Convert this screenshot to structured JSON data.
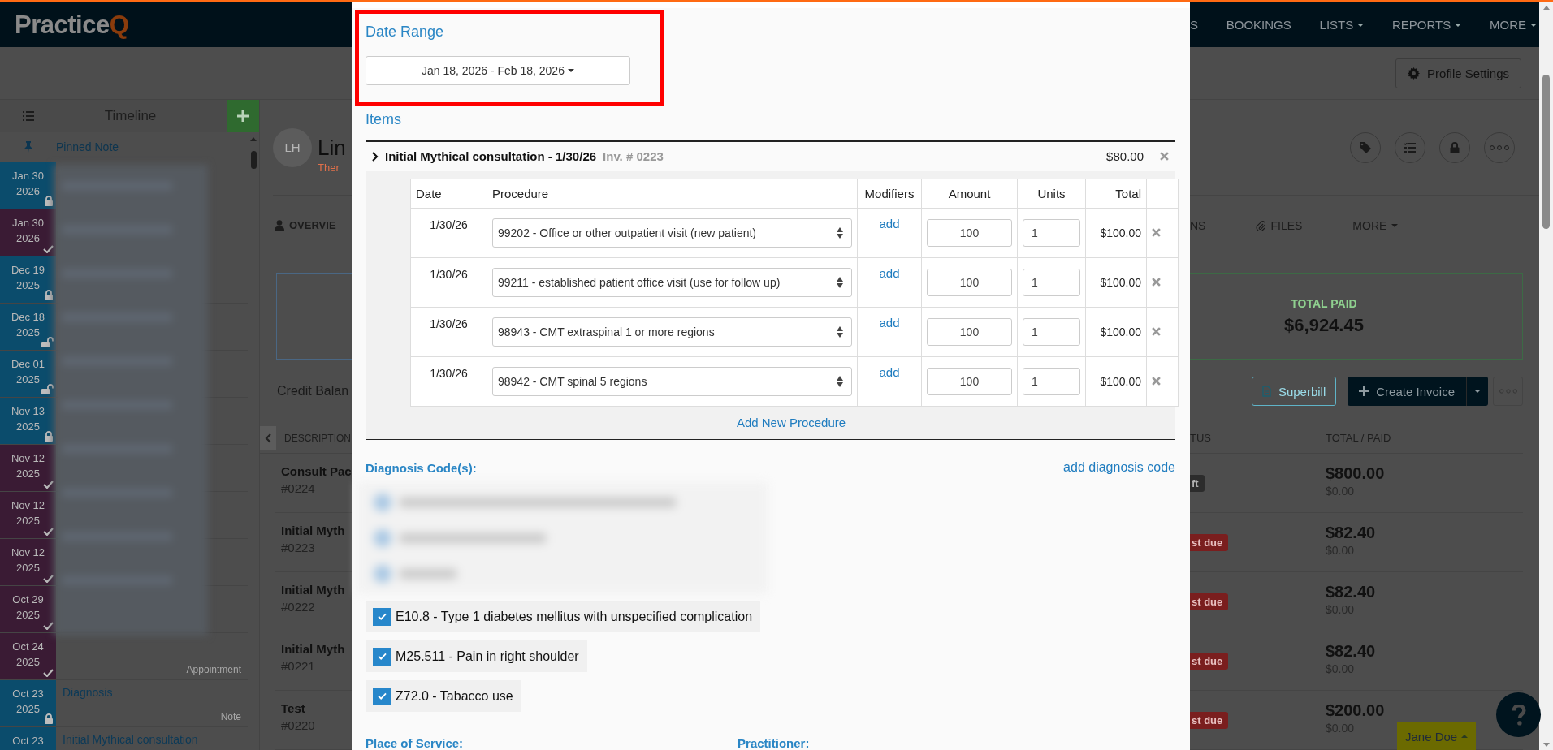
{
  "nav": {
    "logo": {
      "text": "Practice",
      "accent": "Q"
    },
    "items": [
      {
        "label": "S",
        "dropdown": false
      },
      {
        "label": "BOOKINGS",
        "dropdown": false
      },
      {
        "label": "LISTS",
        "dropdown": true
      },
      {
        "label": "REPORTS",
        "dropdown": true
      },
      {
        "label": "MORE",
        "dropdown": true
      }
    ]
  },
  "toolbar": {
    "button": "Profile Settings"
  },
  "timeline": {
    "title": "Timeline",
    "pinned": "Pinned Note",
    "entries": [
      {
        "date": "Jan 30",
        "year": "2026",
        "kind": "note",
        "locked": true
      },
      {
        "date": "Jan 30",
        "year": "2026",
        "kind": "appointment",
        "checked": true
      },
      {
        "date": "Dec 19",
        "year": "2025",
        "kind": "note",
        "locked": true
      },
      {
        "date": "Dec 18",
        "year": "2025",
        "kind": "note",
        "locked": false
      },
      {
        "date": "Dec 01",
        "year": "2025",
        "kind": "note",
        "locked": false
      },
      {
        "date": "Nov 13",
        "year": "2025",
        "kind": "note",
        "locked": true
      },
      {
        "date": "Nov 12",
        "year": "2025",
        "kind": "appointment",
        "checked": true
      },
      {
        "date": "Nov 12",
        "year": "2025",
        "kind": "appointment",
        "checked": true
      },
      {
        "date": "Nov 12",
        "year": "2025",
        "kind": "appointment",
        "checked": true
      },
      {
        "date": "Oct 29",
        "year": "2025",
        "kind": "appointment",
        "checked": true
      },
      {
        "date": "Oct 24",
        "year": "2025",
        "kind": "appointment",
        "checked": true,
        "type": "Appointment"
      },
      {
        "date": "Oct 23",
        "year": "2025",
        "kind": "note",
        "locked": true,
        "title": "Diagnosis",
        "type": "Note"
      },
      {
        "date": "Oct 23",
        "kind": "note",
        "title": "Initial Mythical consultation"
      }
    ]
  },
  "profile": {
    "initials": "LH",
    "name": "Lin",
    "subtitle": "Ther"
  },
  "profile_tabs_left": [
    {
      "label": "OVERVIE"
    }
  ],
  "profile_tabs_right": [
    {
      "label": "NS",
      "dropdown": false
    },
    {
      "label": "FILES",
      "dropdown": false
    },
    {
      "label": "MORE",
      "dropdown": true
    }
  ],
  "summary": {
    "label": "TOTAL PAID",
    "value": "$6,924.45"
  },
  "credit_balance": "Credit Balan",
  "invoice_actions": {
    "superbill": "Superbill",
    "create": "Create Invoice"
  },
  "invoices": {
    "columns_left": [
      "DESCRIPTION"
    ],
    "columns_right": [
      "TUS",
      "TOTAL / PAID"
    ],
    "rows": [
      {
        "description": "Consult Pac",
        "number": "#0224",
        "status": "ft",
        "kind": "draft",
        "total": "$800.00",
        "paid": "$0.00"
      },
      {
        "description": "Initial Myth",
        "number": "#0223",
        "status": "st due",
        "kind": "overdue",
        "total": "$82.40",
        "paid": "$0.00"
      },
      {
        "description": "Initial Myth",
        "number": "#0222",
        "status": "st due",
        "kind": "overdue",
        "total": "$82.40",
        "paid": "$0.00"
      },
      {
        "description": "Initial Myth",
        "number": "#0221",
        "status": "st due",
        "kind": "overdue",
        "total": "$82.40",
        "paid": "$0.00"
      },
      {
        "description": "Test",
        "number": "#0220",
        "status": "st due",
        "kind": "overdue",
        "total": "$200.00",
        "paid": "$0.00"
      }
    ]
  },
  "user_menu": "Jane Doe",
  "modal": {
    "date_range": {
      "title": "Date Range",
      "value": "Jan 18, 2026 - Feb 18, 2026",
      "highlighted": true
    },
    "items_title": "Items",
    "item": {
      "title": "Initial Mythical consultation - 1/30/26",
      "invoice": "Inv. # 0223",
      "amount": "$80.00"
    },
    "columns": [
      "Date",
      "Procedure",
      "Modifiers",
      "Amount",
      "Units",
      "Total"
    ],
    "procedures": [
      {
        "date": "1/30/26",
        "procedure": "99202 - Office or other outpatient visit (new patient)",
        "modifier": "add",
        "amount": "100",
        "units": "1",
        "total": "$100.00"
      },
      {
        "date": "1/30/26",
        "procedure": "99211 - established patient office visit (use for follow up)",
        "modifier": "add",
        "amount": "100",
        "units": "1",
        "total": "$100.00"
      },
      {
        "date": "1/30/26",
        "procedure": "98943 - CMT extraspinal 1 or more regions",
        "modifier": "add",
        "amount": "100",
        "units": "1",
        "total": "$100.00"
      },
      {
        "date": "1/30/26",
        "procedure": "98942 - CMT spinal 5 regions",
        "modifier": "add",
        "amount": "100",
        "units": "1",
        "total": "$100.00"
      }
    ],
    "add_procedure": "Add New Procedure",
    "diagnosis": {
      "title": "Diagnosis Code(s):",
      "add": "add diagnosis code",
      "codes": [
        {
          "label": "E10.8 - Type 1 diabetes mellitus with unspecified complication",
          "checked": true
        },
        {
          "label": "M25.511 - Pain in right shoulder",
          "checked": true
        },
        {
          "label": "Z72.0 - Tabacco use",
          "checked": true
        }
      ]
    },
    "place_of_service": "Place of Service:",
    "practitioner": "Practitioner:"
  }
}
